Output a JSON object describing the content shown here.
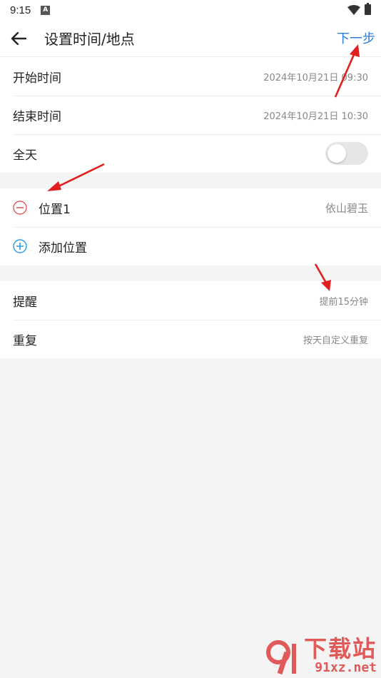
{
  "status_bar": {
    "time": "9:15"
  },
  "app_bar": {
    "title": "设置时间/地点",
    "next_label": "下一步"
  },
  "time_section": {
    "start_label": "开始时间",
    "start_value": "2024年10月21日 09:30",
    "end_label": "结束时间",
    "end_value": "2024年10月21日 10:30",
    "allday_label": "全天",
    "allday_on": false
  },
  "location_section": {
    "location_label": "位置1",
    "location_value": "依山碧玉",
    "add_label": "添加位置"
  },
  "reminder_section": {
    "reminder_label": "提醒",
    "reminder_value": "提前15分钟",
    "repeat_label": "重复",
    "repeat_value": "按天自定义重复"
  },
  "watermark": {
    "top": "下载站",
    "bottom": "91xz.net"
  },
  "colors": {
    "accent": "#2c7be5",
    "remove": "#e05a5a",
    "add": "#2c9be5",
    "annotation": "#e02020"
  }
}
